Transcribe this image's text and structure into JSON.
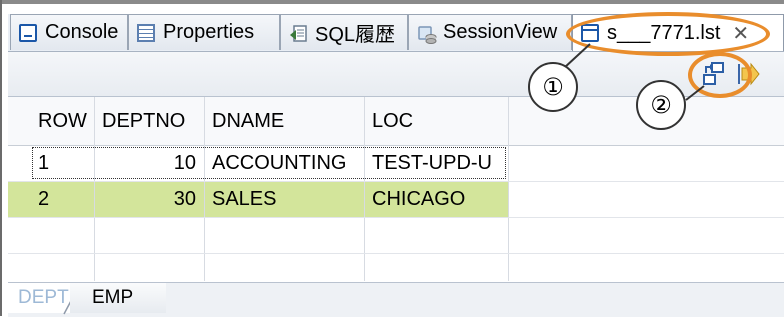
{
  "tabs": [
    {
      "label": "Console",
      "icon": "console-icon"
    },
    {
      "label": "Properties",
      "icon": "properties-icon"
    },
    {
      "label": "SQL履歴",
      "icon": "sql-history-icon"
    },
    {
      "label": "SessionView",
      "icon": "session-view-icon"
    },
    {
      "label": "s___7771.lst",
      "icon": "list-file-icon",
      "active": true,
      "close_glyph": "✕"
    }
  ],
  "grid": {
    "columns": [
      "ROW",
      "DEPTNO",
      "DNAME",
      "LOC"
    ],
    "rows": [
      [
        "1",
        "10",
        "ACCOUNTING",
        "TEST-UPD-U"
      ],
      [
        "2",
        "30",
        "SALES",
        "CHICAGO"
      ]
    ]
  },
  "bottom_tabs": [
    {
      "label": "DEPT",
      "selected": true
    },
    {
      "label": "EMP",
      "selected": false
    }
  ],
  "annotations": {
    "callout_1": "①",
    "callout_2": "②"
  },
  "colors": {
    "highlight_row": "#d3e59b",
    "annotation_orange": "#e98d2c",
    "selected_tab_text": "#9eb9d6"
  }
}
